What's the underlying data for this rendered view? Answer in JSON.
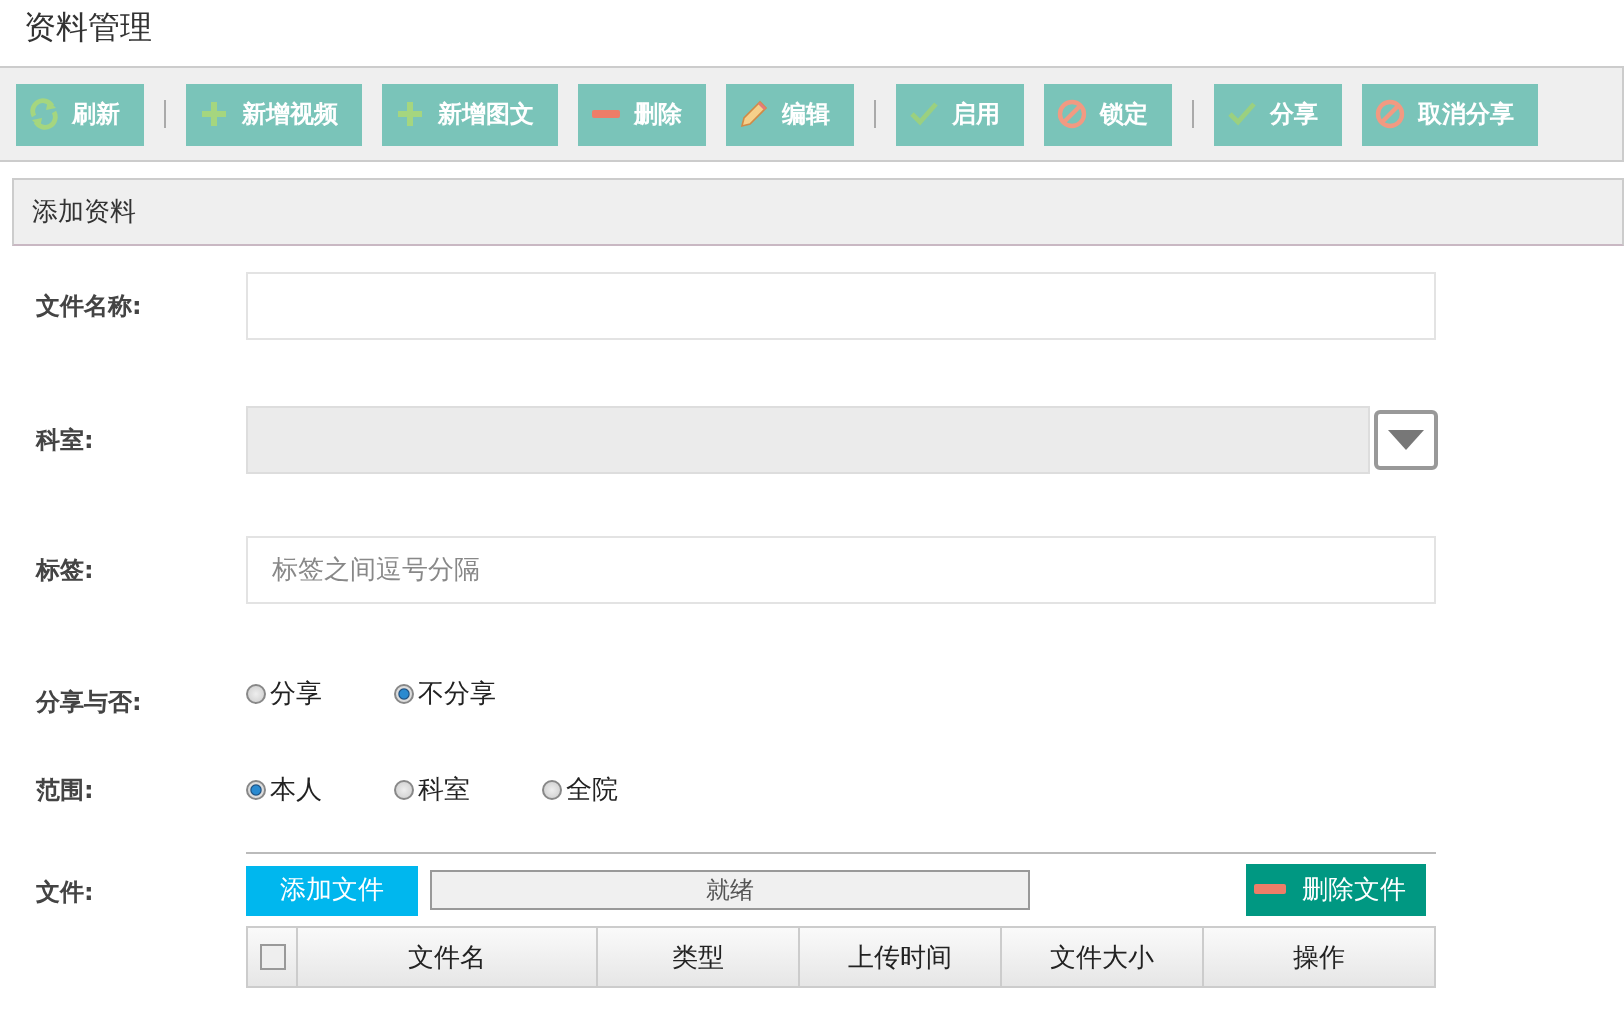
{
  "page_title": "资料管理",
  "toolbar": [
    {
      "kind": "refresh",
      "label": "刷新"
    },
    {
      "kind": "separator"
    },
    {
      "kind": "plus",
      "label": "新增视频"
    },
    {
      "kind": "plus",
      "label": "新增图文"
    },
    {
      "kind": "minus",
      "label": "删除"
    },
    {
      "kind": "pencil",
      "label": "编辑"
    },
    {
      "kind": "separator"
    },
    {
      "kind": "check",
      "label": "启用"
    },
    {
      "kind": "forbid",
      "label": "锁定"
    },
    {
      "kind": "separator"
    },
    {
      "kind": "check",
      "label": "分享"
    },
    {
      "kind": "forbid",
      "label": "取消分享"
    }
  ],
  "panel_title": "添加资料",
  "form": {
    "name": {
      "label": "文件名称:"
    },
    "department": {
      "label": "科室:",
      "disabled": true
    },
    "tags": {
      "label": "标签:",
      "placeholder": "标签之间逗号分隔"
    },
    "share": {
      "label": "分享与否:",
      "options": [
        {
          "label": "分享",
          "selected": false
        },
        {
          "label": "不分享",
          "selected": true
        }
      ]
    },
    "scope": {
      "label": "范围:",
      "options": [
        {
          "label": "本人",
          "selected": true
        },
        {
          "label": "科室",
          "selected": false
        },
        {
          "label": "全院",
          "selected": false
        }
      ]
    },
    "files": {
      "label": "文件:",
      "add_button": "添加文件",
      "progress": "就绪",
      "delete_button": "删除文件",
      "select_all_checked": false,
      "columns": [
        "文件名",
        "类型",
        "上传时间",
        "文件大小",
        "操作"
      ]
    }
  }
}
